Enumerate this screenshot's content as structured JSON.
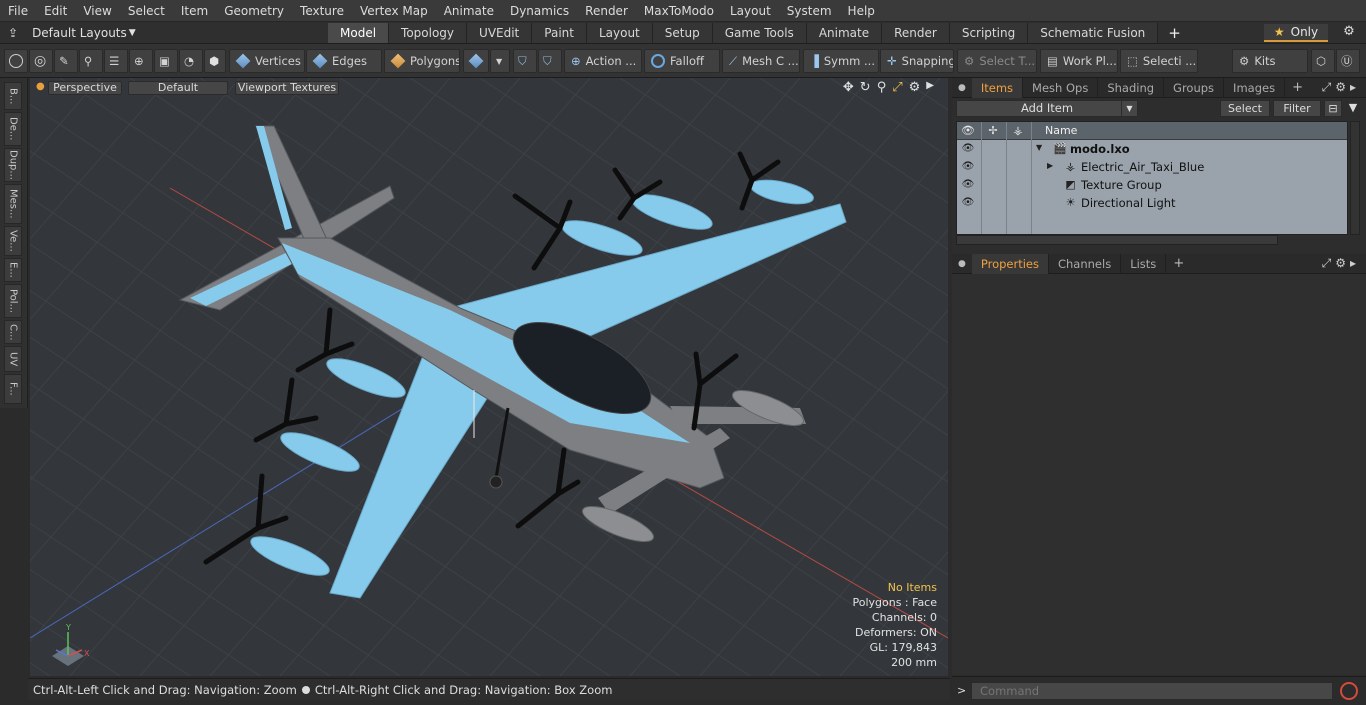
{
  "menu": [
    "File",
    "Edit",
    "View",
    "Select",
    "Item",
    "Geometry",
    "Texture",
    "Vertex Map",
    "Animate",
    "Dynamics",
    "Render",
    "MaxToModo",
    "Layout",
    "System",
    "Help"
  ],
  "layout": {
    "selector": "Default Layouts",
    "tabs": [
      "Model",
      "Topology",
      "UVEdit",
      "Paint",
      "Layout",
      "Setup",
      "Game Tools",
      "Animate",
      "Render",
      "Scripting",
      "Schematic Fusion"
    ],
    "active_tab": "Model",
    "add_tab": "+",
    "only_label": "Only",
    "accent": "#d69a3a"
  },
  "toolbar": {
    "vertices": "Vertices",
    "edges": "Edges",
    "polygons": "Polygons",
    "action": "Action ...",
    "falloff": "Falloff",
    "mesh_c": "Mesh C ...",
    "symm": "Symm ...",
    "snapping": "Snapping",
    "select_t": "Select T...",
    "work_pl": "Work Pl...",
    "selecti": "Selecti ...",
    "kits": "Kits"
  },
  "left_tabs": [
    "B...",
    "De...",
    "Dup...",
    "Mes...",
    "Ve...",
    "E...",
    "Pol...",
    "C...",
    "UV",
    "F..."
  ],
  "viewport": {
    "view_mode": "Perspective",
    "shading": "Default",
    "textures": "Viewport Textures",
    "info": {
      "no_items": "No Items",
      "polygons": "Polygons : Face",
      "channels": "Channels: 0",
      "deformers": "Deformers: ON",
      "gl": "GL: 179,843",
      "scale": "200 mm"
    },
    "model_color": "#87cbec",
    "grid_color": "#3d4247"
  },
  "status": {
    "hint1": "Ctrl-Alt-Left Click and Drag: Navigation: Zoom",
    "hint2": "Ctrl-Alt-Right Click and Drag: Navigation: Box Zoom"
  },
  "items_panel": {
    "tabs": [
      "Items",
      "Mesh Ops",
      "Shading",
      "Groups",
      "Images"
    ],
    "active": "Items",
    "add_item": "Add Item",
    "select": "Select",
    "filter": "Filter",
    "column_name": "Name",
    "rows": [
      {
        "name": "modo.lxo",
        "bold": true,
        "icon": "scene-icon"
      },
      {
        "name": "Electric_Air_Taxi_Blue",
        "bold": false,
        "icon": "mesh-icon"
      },
      {
        "name": "Texture Group",
        "bold": false,
        "icon": "texture-group-icon"
      },
      {
        "name": "Directional Light",
        "bold": false,
        "icon": "light-icon"
      }
    ]
  },
  "props_panel": {
    "tabs": [
      "Properties",
      "Channels",
      "Lists"
    ],
    "active": "Properties"
  },
  "command": {
    "placeholder": "Command"
  }
}
